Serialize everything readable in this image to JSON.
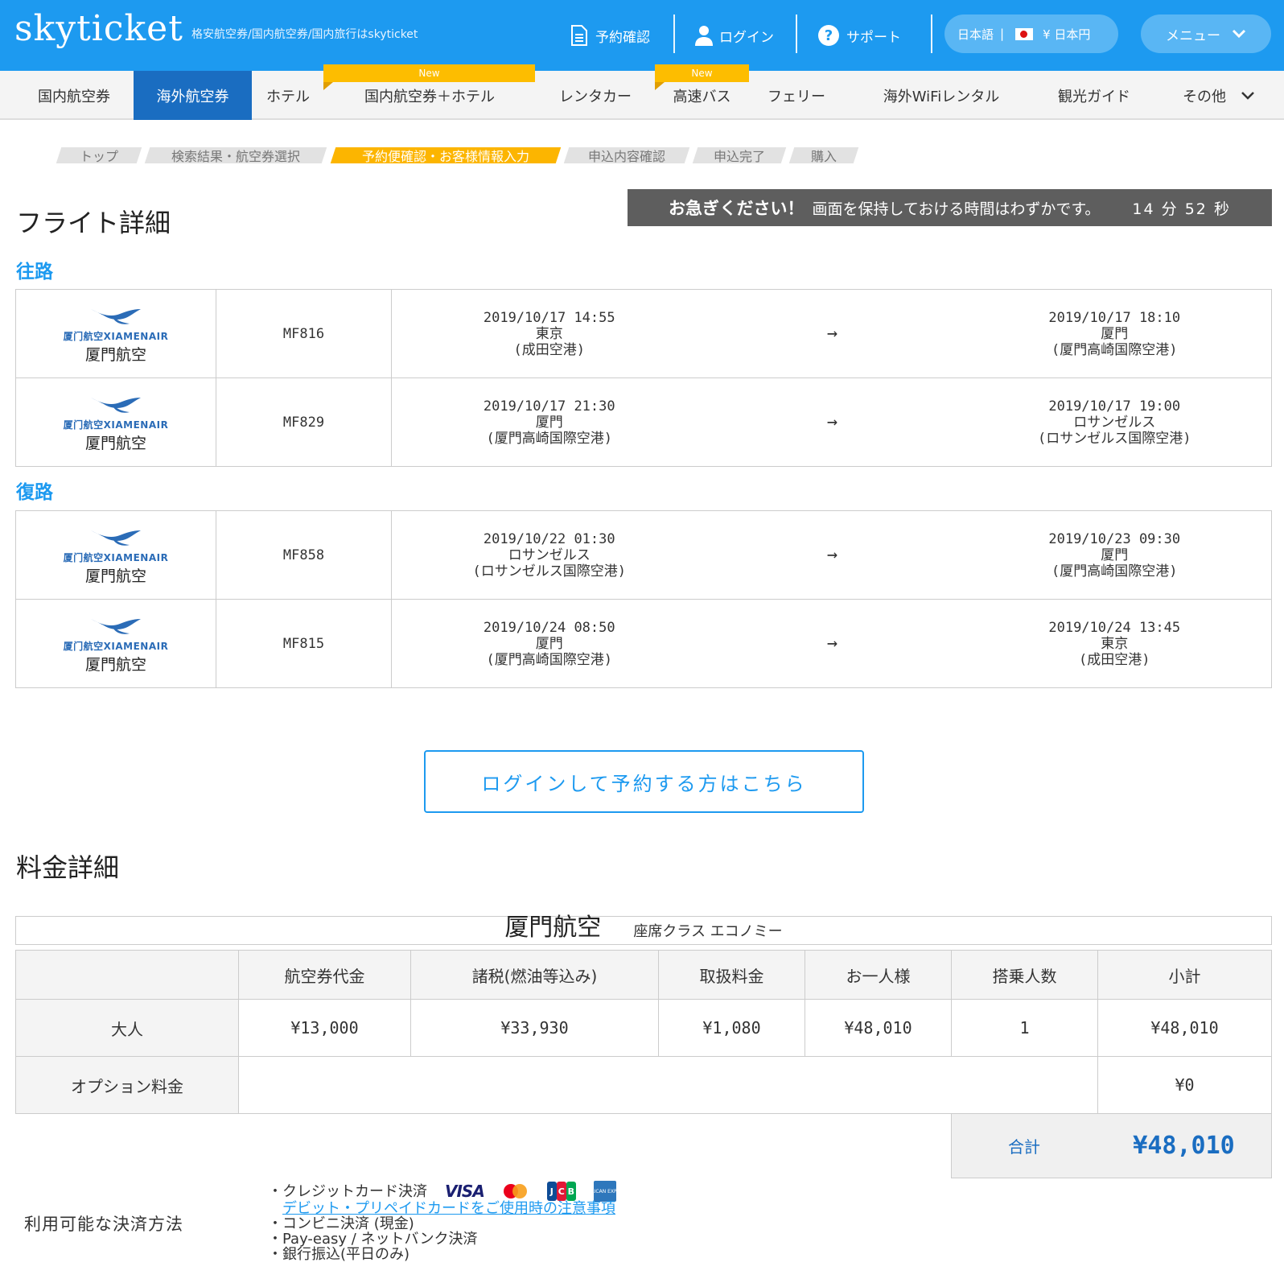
{
  "header": {
    "logo": "skyticket",
    "tagline": "格安航空券/国内航空券/国内旅行はskyticket",
    "reservation_check": "予約確認",
    "login": "ログイン",
    "support": "サポート",
    "language": "日本語",
    "currency": "¥ 日本円",
    "menu": "メニュー",
    "brand_color": "#1d9af0"
  },
  "categories": [
    {
      "label": "国内航空券"
    },
    {
      "label": "海外航空券",
      "active": true
    },
    {
      "label": "ホテル"
    },
    {
      "label": "国内航空券＋ホテル",
      "badge": "New"
    },
    {
      "label": "レンタカー"
    },
    {
      "label": "高速バス",
      "badge": "New"
    },
    {
      "label": "フェリー"
    },
    {
      "label": "海外WiFiレンタル"
    },
    {
      "label": "観光ガイド"
    },
    {
      "label": "その他"
    }
  ],
  "steps": [
    {
      "label": "トップ"
    },
    {
      "label": "検索結果・航空券選択"
    },
    {
      "label": "予約便確認・お客様情報入力",
      "active": true
    },
    {
      "label": "申込内容確認"
    },
    {
      "label": "申込完了"
    },
    {
      "label": "購入"
    }
  ],
  "timer": {
    "lead": "お急ぎください！",
    "message": "画面を保持しておける時間はわずかです。",
    "minutes": "14",
    "min_unit": "分",
    "seconds": "52",
    "sec_unit": "秒"
  },
  "flight_section": {
    "title": "フライト詳細",
    "outbound_label": "往路",
    "return_label": "復路",
    "airline_logo_text": "厦门航空XIAMENAIR",
    "arrow": "→"
  },
  "outbound": [
    {
      "airline": "厦門航空",
      "flight": "MF816",
      "dep_time": "2019/10/17 14:55",
      "dep_city": "東京",
      "dep_airport": "(成田空港)",
      "arr_time": "2019/10/17 18:10",
      "arr_city": "厦門",
      "arr_airport": "(厦門高崎国際空港)"
    },
    {
      "airline": "厦門航空",
      "flight": "MF829",
      "dep_time": "2019/10/17 21:30",
      "dep_city": "厦門",
      "dep_airport": "(厦門高崎国際空港)",
      "arr_time": "2019/10/17 19:00",
      "arr_city": "ロサンゼルス",
      "arr_airport": "(ロサンゼルス国際空港)"
    }
  ],
  "return": [
    {
      "airline": "厦門航空",
      "flight": "MF858",
      "dep_time": "2019/10/22 01:30",
      "dep_city": "ロサンゼルス",
      "dep_airport": "(ロサンゼルス国際空港)",
      "arr_time": "2019/10/23 09:30",
      "arr_city": "厦門",
      "arr_airport": "(厦門高崎国際空港)"
    },
    {
      "airline": "厦門航空",
      "flight": "MF815",
      "dep_time": "2019/10/24 08:50",
      "dep_city": "厦門",
      "dep_airport": "(厦門高崎国際空港)",
      "arr_time": "2019/10/24 13:45",
      "arr_city": "東京",
      "arr_airport": "(成田空港)"
    }
  ],
  "login_button": "ログインして予約する方はこちら",
  "fare": {
    "title": "料金詳細",
    "airline": "厦門航空",
    "seat_class": "座席クラス エコノミー",
    "headers": [
      "航空券代金",
      "諸税(燃油等込み)",
      "取扱料金",
      "お一人様",
      "搭乗人数",
      "小計"
    ],
    "adult": {
      "label": "大人",
      "ticket": "¥13,000",
      "tax": "¥33,930",
      "fee": "¥1,080",
      "per_person": "¥48,010",
      "count": "1",
      "subtotal": "¥48,010"
    },
    "option": {
      "label": "オプション料金",
      "amount": "¥0"
    },
    "total_label": "合計",
    "total_value": "¥48,010"
  },
  "payment": {
    "label": "利用可能な決済方法",
    "credit": "・クレジットカード決済",
    "debit_link": "デビット・プリペイドカードをご使用時の注意事項",
    "konbini": "・コンビニ決済 (現金)",
    "payeasy": "・Pay-easy / ネットバンク決済",
    "bank": "・銀行振込(平日のみ)",
    "card_visa": "VISA",
    "card_jcb": "JCB",
    "card_amex": "AMERICAN EXPRESS"
  }
}
